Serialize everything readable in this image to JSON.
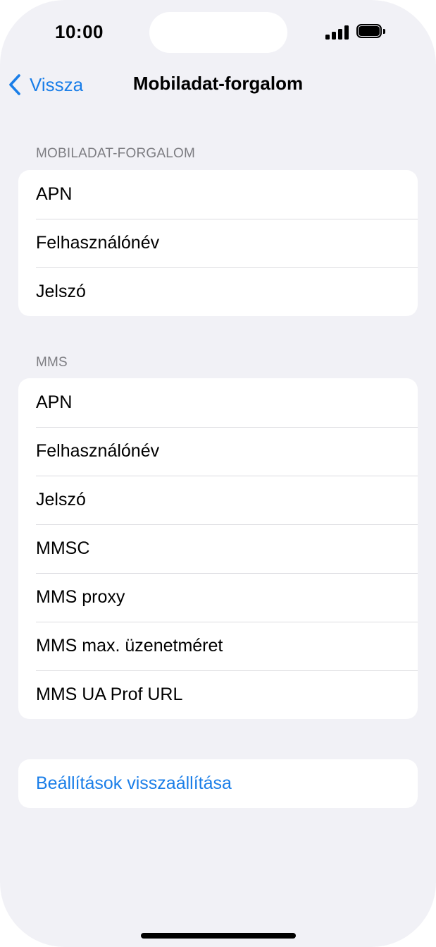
{
  "status_bar": {
    "time": "10:00"
  },
  "nav": {
    "back_label": "Vissza",
    "title": "Mobiladat-forgalom"
  },
  "sections": {
    "cellular": {
      "header": "MOBILADAT-FORGALOM",
      "rows": [
        "APN",
        "Felhasználónév",
        "Jelszó"
      ]
    },
    "mms": {
      "header": "MMS",
      "rows": [
        "APN",
        "Felhasználónév",
        "Jelszó",
        "MMSC",
        "MMS proxy",
        "MMS max. üzenetméret",
        "MMS UA Prof URL"
      ]
    },
    "reset": {
      "label": "Beállítások visszaállítása"
    }
  },
  "colors": {
    "accent": "#1a7ee8",
    "background": "#f1f1f6",
    "section_header": "#7d7d82"
  }
}
